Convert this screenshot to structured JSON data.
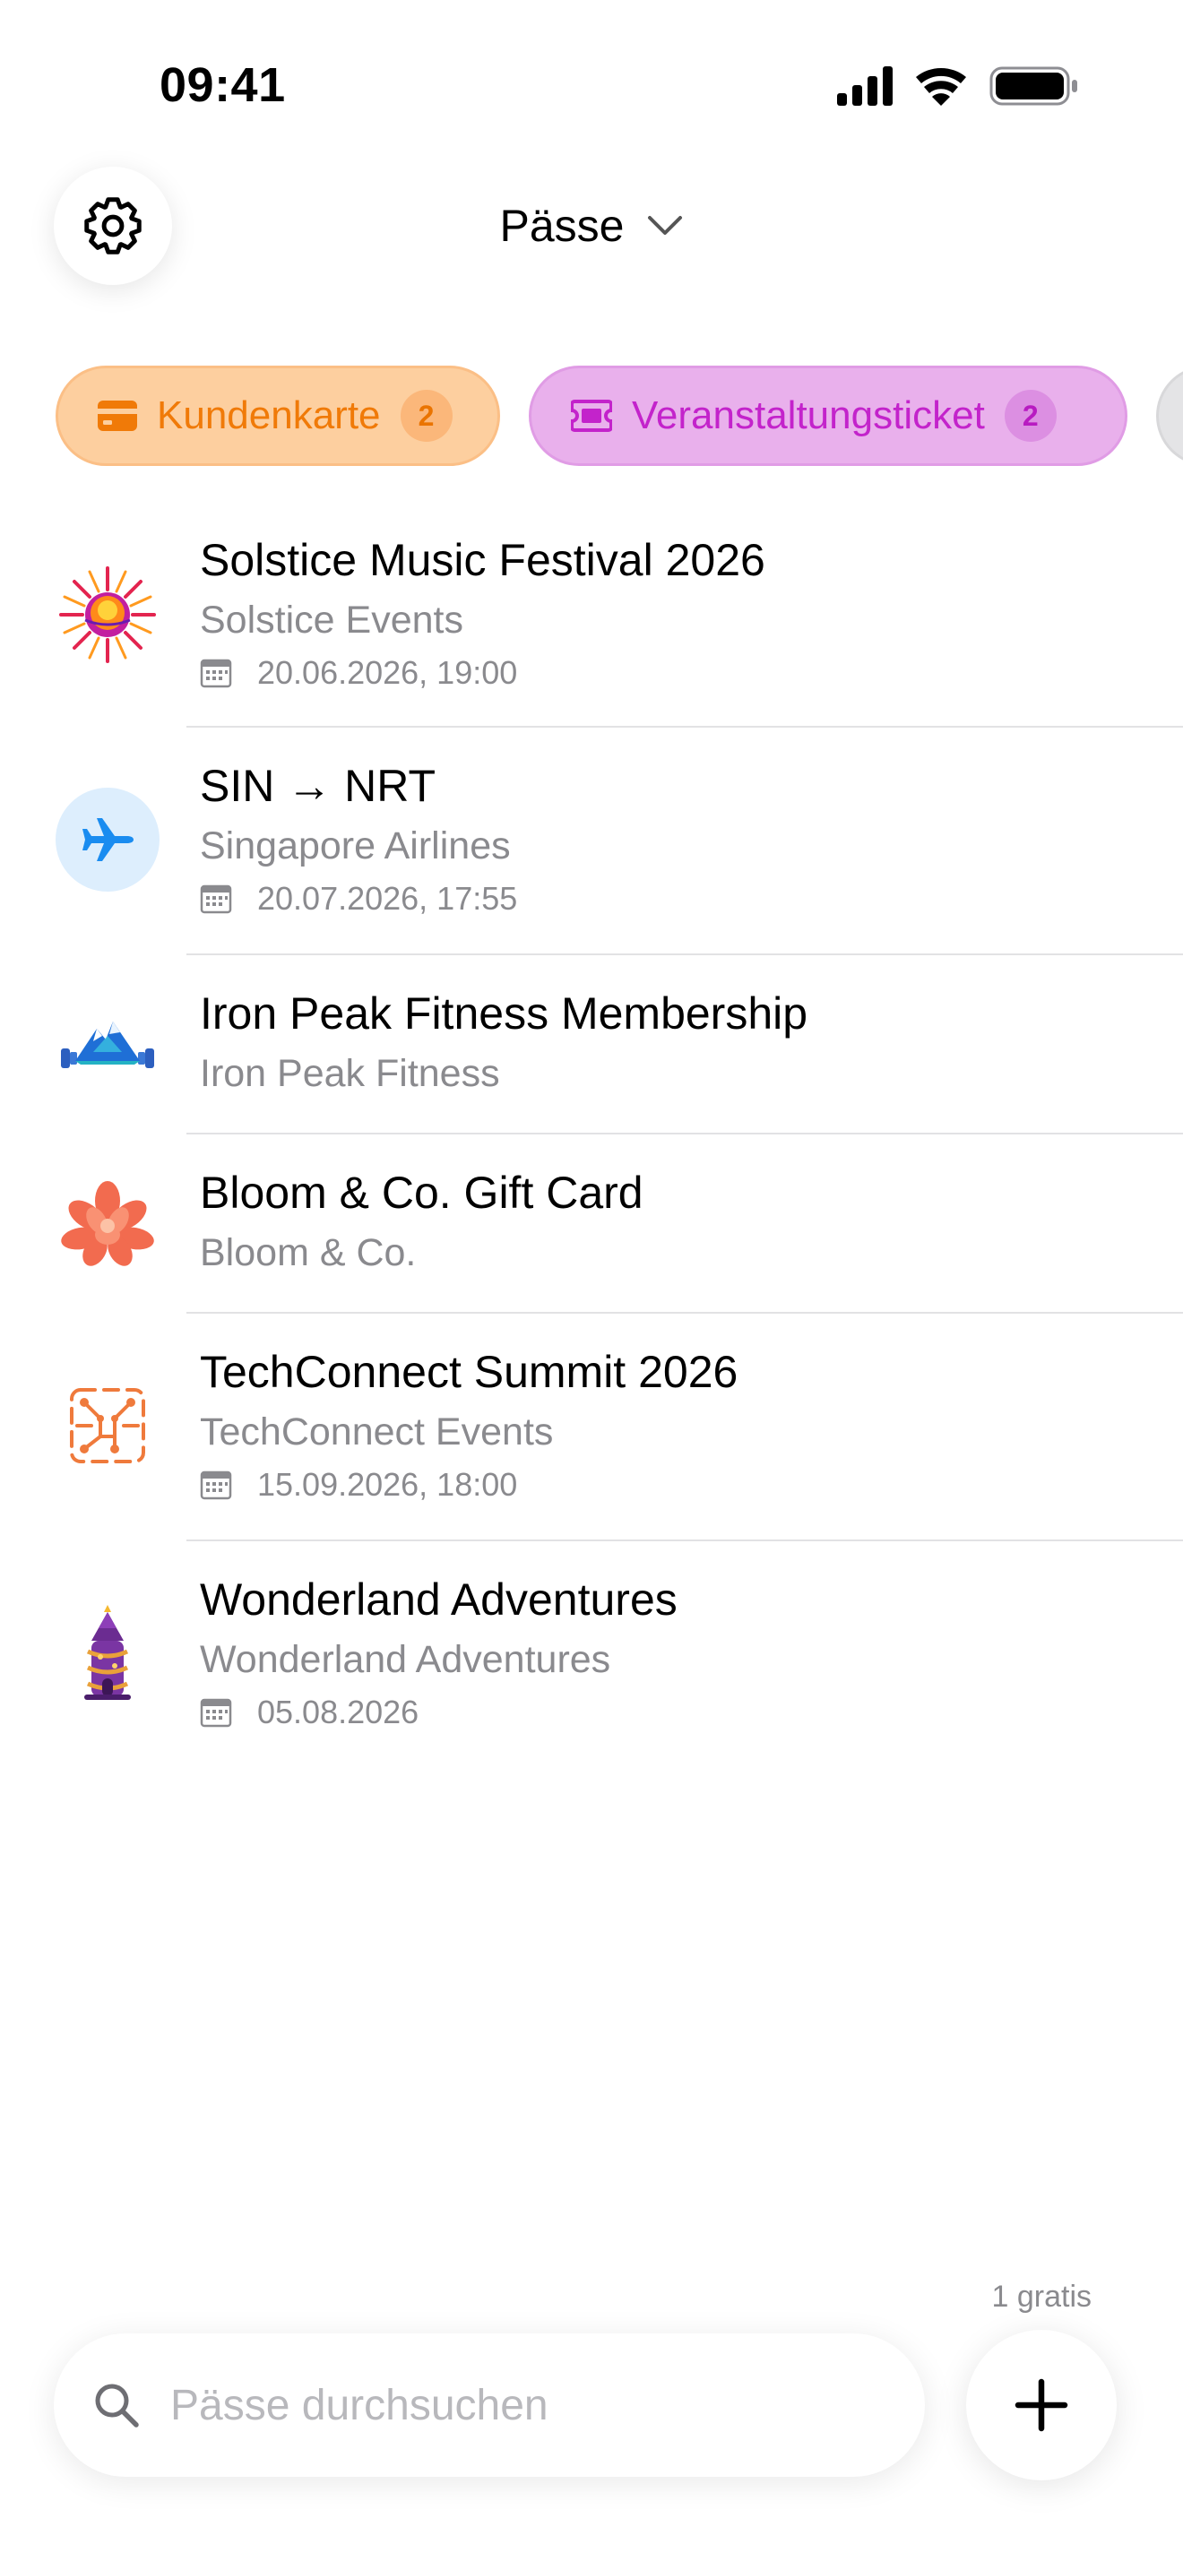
{
  "status_bar": {
    "time": "09:41",
    "icons": [
      "cellular-signal-icon",
      "wifi-icon",
      "battery-icon"
    ]
  },
  "header": {
    "title": "Pässe",
    "settings_icon": "gear-icon",
    "dropdown_icon": "chevron-down-icon"
  },
  "filters": [
    {
      "label": "Kundenkarte",
      "count": "2",
      "icon": "credit-card-icon",
      "color": "#f07a08",
      "background": "#fdcf9f"
    },
    {
      "label": "Veranstaltungsticket",
      "count": "2",
      "icon": "ticket-icon",
      "color": "#c323cb",
      "background": "#e9b0ec"
    },
    {
      "label": "",
      "count": "",
      "icon": "",
      "color": "#8a8a8e",
      "background": "#e4e4e6"
    }
  ],
  "passes": [
    {
      "title": "Solstice Music Festival 2026",
      "issuer": "Solstice Events",
      "date": "20.06.2026, 19:00",
      "icon": "sun-festival-logo"
    },
    {
      "title": "SIN → NRT",
      "issuer": "Singapore Airlines",
      "date": "20.07.2026, 17:55",
      "icon": "airplane-icon"
    },
    {
      "title": "Iron Peak Fitness Membership",
      "issuer": "Iron Peak Fitness",
      "icon": "mountain-dumbbell-logo"
    },
    {
      "title": "Bloom & Co. Gift Card",
      "issuer": "Bloom & Co.",
      "icon": "flower-logo"
    },
    {
      "title": "TechConnect Summit 2026",
      "issuer": "TechConnect Events",
      "date": "15.09.2026, 18:00",
      "icon": "circuit-logo"
    },
    {
      "title": "Wonderland Adventures",
      "issuer": "Wonderland Adventures",
      "date": "05.08.2026",
      "icon": "castle-logo"
    }
  ],
  "footer": {
    "free_label": "1 gratis",
    "search_placeholder": "Pässe durchsuchen",
    "search_value": "",
    "add_icon": "plus-icon"
  }
}
